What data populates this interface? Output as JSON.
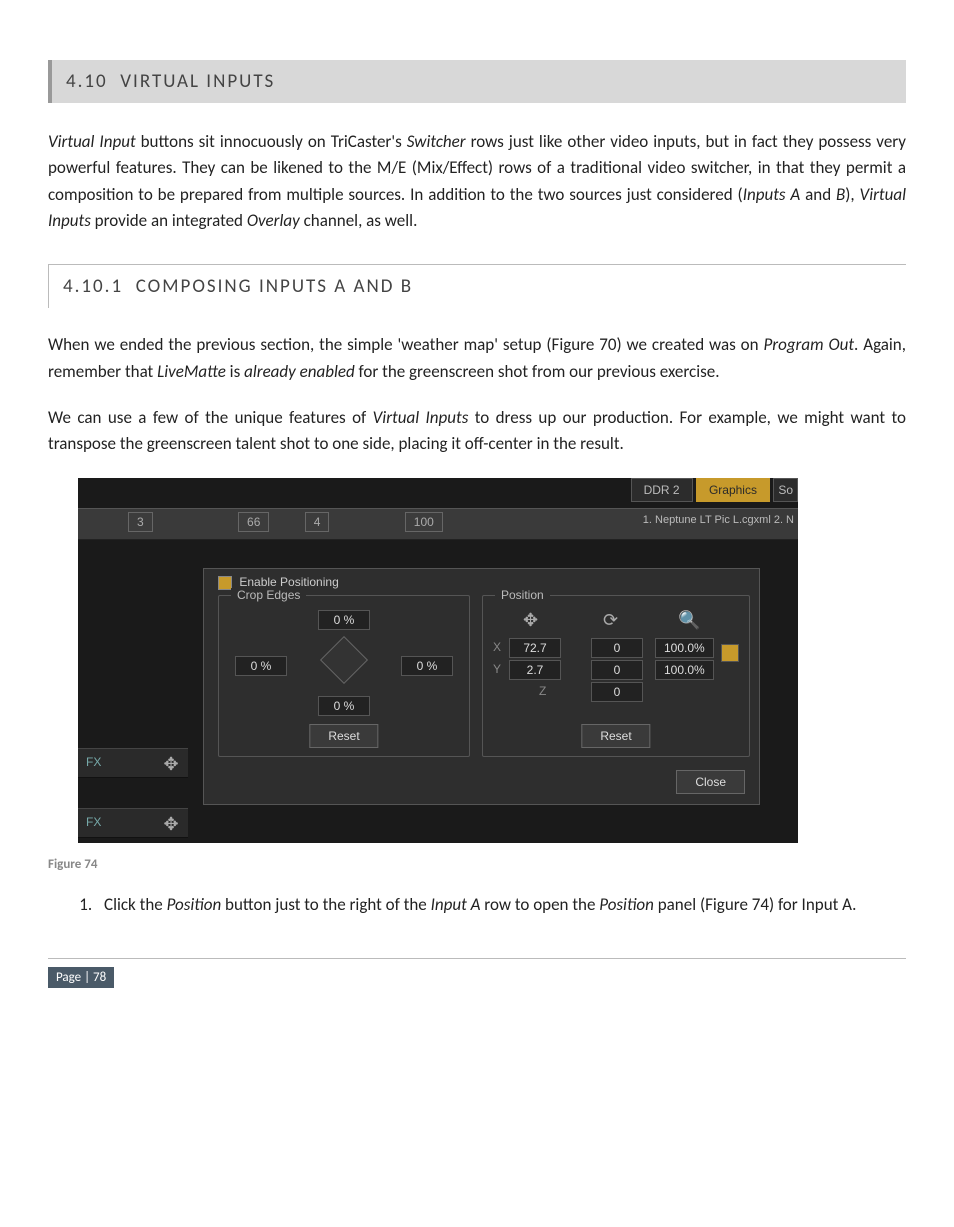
{
  "section": {
    "number": "4.10",
    "title": "VIRTUAL INPUTS"
  },
  "paragraph1_parts": {
    "a": "Virtual Input",
    "b": " buttons sit innocuously on TriCaster's ",
    "c": "Switcher",
    "d": " rows just like other video inputs, but in fact they possess very powerful features.  They can be likened to the M/E (Mix/Effect) rows of a traditional video switcher, in that they permit a composition to be prepared from multiple sources.  In addition to the two sources just considered (",
    "e": "Inputs A",
    "f": " and ",
    "g": "B",
    "h": "), ",
    "i": "Virtual Inputs",
    "j": " provide an integrated ",
    "k": "Overlay",
    "l": " channel, as well."
  },
  "subsection": {
    "number": "4.10.1",
    "title": "COMPOSING INPUTS A AND B"
  },
  "paragraph2_parts": {
    "a": "When we ended the previous section, the simple 'weather map' setup (Figure 70) we created was on ",
    "b": "Program Out",
    "c": ".  Again, remember that ",
    "d": "LiveMatte",
    "e": " is ",
    "f": "already enabled",
    "g": " for the greenscreen shot from our previous exercise."
  },
  "paragraph3_parts": {
    "a": "We can use a few of the unique features of ",
    "b": "Virtual Inputs",
    "c": " to dress up our production.  For example, we might want to transpose the greenscreen talent shot to one side, placing it off-center in the result."
  },
  "figure_caption": "Figure 74",
  "step1_parts": {
    "a": "Click the ",
    "b": "Position",
    "c": " button just to the right of the ",
    "d": "Input A",
    "e": " row to open the ",
    "f": "Position",
    "g": " panel (Figure 74) for Input A."
  },
  "footer": {
    "page_label": "Page | 78"
  },
  "ui": {
    "tabs": {
      "ddr2": "DDR 2",
      "graphics": "Graphics",
      "so": "So"
    },
    "row_numbers": {
      "n3": "3",
      "n66": "66",
      "n4": "4",
      "n100": "100"
    },
    "row_right": "1. Neptune LT Pic L.cgxml  2. N",
    "panel": {
      "enable": "Enable Positioning",
      "crop_title": "Crop Edges",
      "crop_top": "0 %",
      "crop_left": "0 %",
      "crop_right": "0 %",
      "crop_bottom": "0 %",
      "pos_title": "Position",
      "x_label": "X",
      "x_val": "72.7",
      "y_label": "Y",
      "y_val": "2.7",
      "z_label": "Z",
      "rot_x": "0",
      "rot_y": "0",
      "rot_z": "0",
      "scale_x": "100.0%",
      "scale_y": "100.0%",
      "reset": "Reset",
      "close": "Close"
    },
    "fx_label": "FX"
  }
}
